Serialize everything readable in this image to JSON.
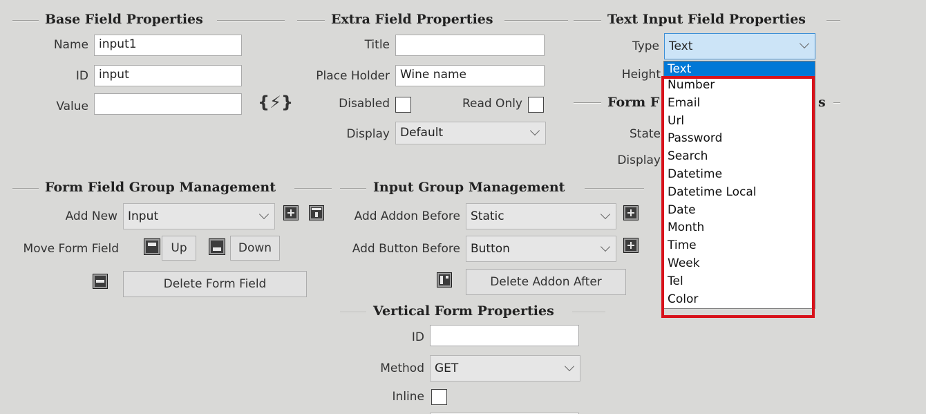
{
  "base_field": {
    "title": "Base Field Properties",
    "name_label": "Name",
    "name_value": "input1",
    "id_label": "ID",
    "id_value": "input",
    "value_label": "Value",
    "value_value": "",
    "macro_icon_text": "{⚡}"
  },
  "extra_field": {
    "title": "Extra Field Properties",
    "title_label": "Title",
    "title_value": "",
    "placeholder_label": "Place Holder",
    "placeholder_value": "Wine name",
    "disabled_label": "Disabled",
    "readonly_label": "Read Only",
    "display_label": "Display",
    "display_value": "Default"
  },
  "text_input": {
    "title": "Text Input Field Properties",
    "type_label": "Type",
    "type_value": "Text",
    "height_label": "Height"
  },
  "form_field": {
    "title_visible": "Form F",
    "title_tail": "s",
    "state_label": "State",
    "display_label": "Display"
  },
  "type_dropdown": {
    "options": [
      "Text",
      "Number",
      "Email",
      "Url",
      "Password",
      "Search",
      "Datetime",
      "Datetime Local",
      "Date",
      "Month",
      "Time",
      "Week",
      "Tel",
      "Color"
    ],
    "selected": "Text"
  },
  "group_mgmt": {
    "title": "Form Field Group Management",
    "add_new_label": "Add New",
    "add_new_value": "Input",
    "move_label": "Move Form Field",
    "up_label": "Up",
    "down_label": "Down",
    "delete_label": "Delete Form Field"
  },
  "input_group": {
    "title": "Input Group Management",
    "addon_before_label": "Add Addon Before",
    "addon_before_value": "Static",
    "button_before_label": "Add Button Before",
    "button_before_value": "Button",
    "delete_addon_label": "Delete Addon After"
  },
  "vertical_form": {
    "title": "Vertical Form Properties",
    "id_label": "ID",
    "id_value": "",
    "method_label": "Method",
    "method_value": "GET",
    "inline_label": "Inline"
  },
  "colors": {
    "background": "#d9d9d7",
    "selection": "#0078d7",
    "highlight": "#d8121b"
  }
}
